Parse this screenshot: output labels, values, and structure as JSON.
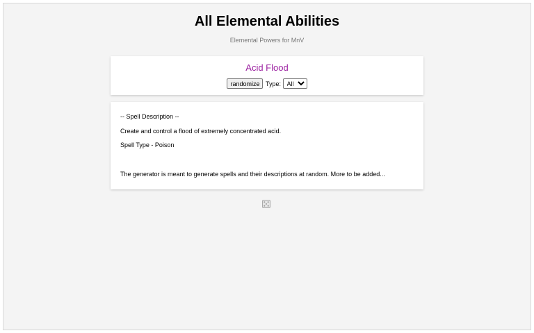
{
  "header": {
    "title": "All Elemental Abilities",
    "subtitle": "Elemental Powers for MnV"
  },
  "generator": {
    "spell_name": "Acid Flood",
    "randomize_label": "randomize",
    "type_label": "Type:",
    "type_selected": "All",
    "spell_name_color": "#9b1fa0"
  },
  "description": {
    "heading": "-- Spell Description --",
    "text": "Create and control a flood of extremely concentrated acid.",
    "spell_type": "Spell Type - Poison",
    "footer_note": "The generator is meant to generate spells and their descriptions at random. More to be added..."
  },
  "icons": {
    "dice": "dice-icon"
  }
}
